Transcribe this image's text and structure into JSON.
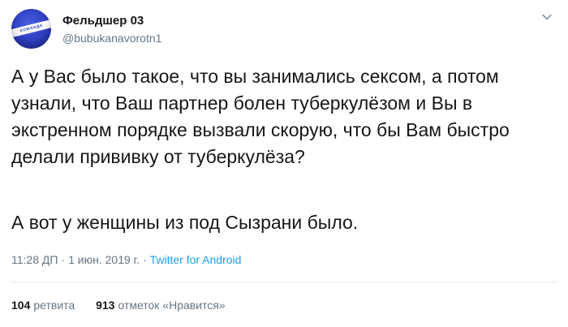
{
  "author": {
    "display_name": "Фельдшер 03",
    "handle": "@bubukanavorotn1",
    "avatar_text": "КОМАНДА ПОМОЩИ"
  },
  "tweet": {
    "text_paragraph_1": "А у Вас было такое, что вы занимались сексом, а потом узнали, что Ваш партнер болен туберкулёзом и Вы в экстренном порядке вызвали скорую, что бы Вам быстро делали прививку от туберкулёза?",
    "text_paragraph_2": "А вот у женщины из под Сызрани было.",
    "time": "11:28 ДП",
    "date": "1 июн. 2019 г.",
    "source": "Twitter for Android",
    "separator": "·"
  },
  "stats": {
    "retweets_count": "104",
    "retweets_label": "ретвита",
    "likes_count": "913",
    "likes_label": "отметок «Нравится»"
  },
  "colors": {
    "text": "#14171a",
    "secondary": "#657786",
    "link": "#1da1f2",
    "divider": "#e6ecf0",
    "avatar": "#2f3fc4"
  },
  "icons": {
    "more": "chevron-down-icon"
  }
}
